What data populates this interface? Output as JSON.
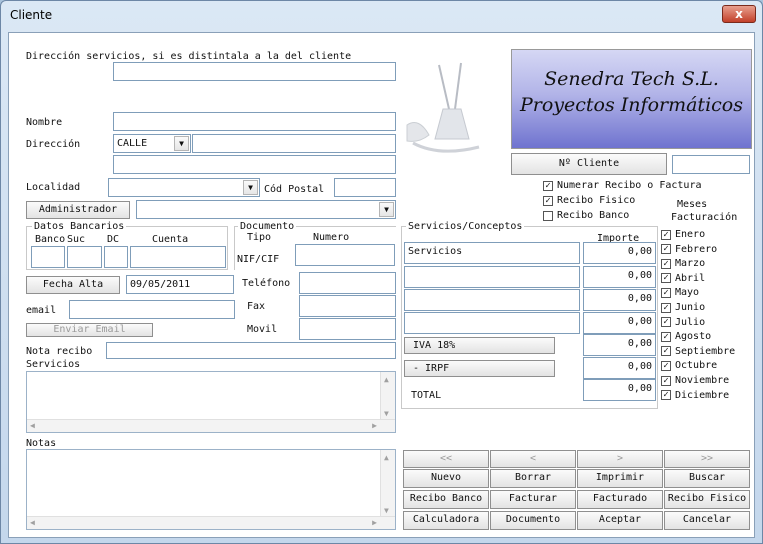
{
  "window": {
    "title": "Cliente",
    "close_label": "x"
  },
  "fields": {
    "direccion_servicios_label": "Dirección servicios, si es distintala a la del cliente",
    "nombre_label": "Nombre",
    "direccion_label": "Dirección",
    "calle_value": "CALLE",
    "localidad_label": "Localidad",
    "cod_postal_label": "Cód Postal",
    "administrador_button": "Administrador",
    "email_label": "email",
    "enviar_email_button": "Enviar Email",
    "nota_recibo_label": "Nota recibo",
    "servicios_label": "Servicios",
    "notas_label": "Notas",
    "fecha_alta_button": "Fecha Alta",
    "fecha_alta_value": "09/05/2011",
    "telefono_label": "Teléfono",
    "fax_label": "Fax",
    "movil_label": "Movil"
  },
  "bank": {
    "legend": "Datos Bancarios",
    "cols": [
      "Banco",
      "Suc",
      "DC",
      "Cuenta"
    ]
  },
  "documento": {
    "legend": "Documento",
    "tipo_label": "Tipo",
    "numero_label": "Numero",
    "nif_label": "NIF/CIF"
  },
  "logo": {
    "line1": "Senedra Tech S.L.",
    "line2": "Proyectos Informáticos"
  },
  "cliente_num_button": "Nº Cliente",
  "options": {
    "numerar": {
      "label": "Numerar Recibo o Factura",
      "checked": true
    },
    "recibo_fisico": {
      "label": "Recibo Fisico",
      "checked": true
    },
    "recibo_banco": {
      "label": "Recibo Banco",
      "checked": false
    }
  },
  "meses": {
    "title_line1": "Meses",
    "title_line2": "Facturación",
    "items": [
      "Enero",
      "Febrero",
      "Marzo",
      "Abril",
      "Mayo",
      "Junio",
      "Julio",
      "Agosto",
      "Septiembre",
      "Octubre",
      "Noviembre",
      "Diciembre"
    ]
  },
  "servicios_conceptos": {
    "legend": "Servicios/Conceptos",
    "importe_label": "Importe",
    "rows": [
      {
        "concepto": "Servicios",
        "importe": "0,00"
      },
      {
        "concepto": "",
        "importe": "0,00"
      },
      {
        "concepto": "",
        "importe": "0,00"
      },
      {
        "concepto": "",
        "importe": "0,00"
      }
    ],
    "iva_button": "IVA 18%",
    "iva_value": "0,00",
    "irpf_button": "- IRPF",
    "irpf_value": "0,00",
    "total_label": "TOTAL",
    "total_value": "0,00"
  },
  "nav": {
    "first": "<<",
    "prev": "<",
    "next": ">",
    "last": ">>"
  },
  "actions": {
    "nuevo": "Nuevo",
    "borrar": "Borrar",
    "imprimir": "Imprimir",
    "buscar": "Buscar",
    "recibo_banco": "Recibo Banco",
    "facturar": "Facturar",
    "facturado": "Facturado",
    "recibo_fisico": "Recibo Fisico",
    "calculadora": "Calculadora",
    "documento": "Documento",
    "aceptar": "Aceptar",
    "cancelar": "Cancelar"
  }
}
